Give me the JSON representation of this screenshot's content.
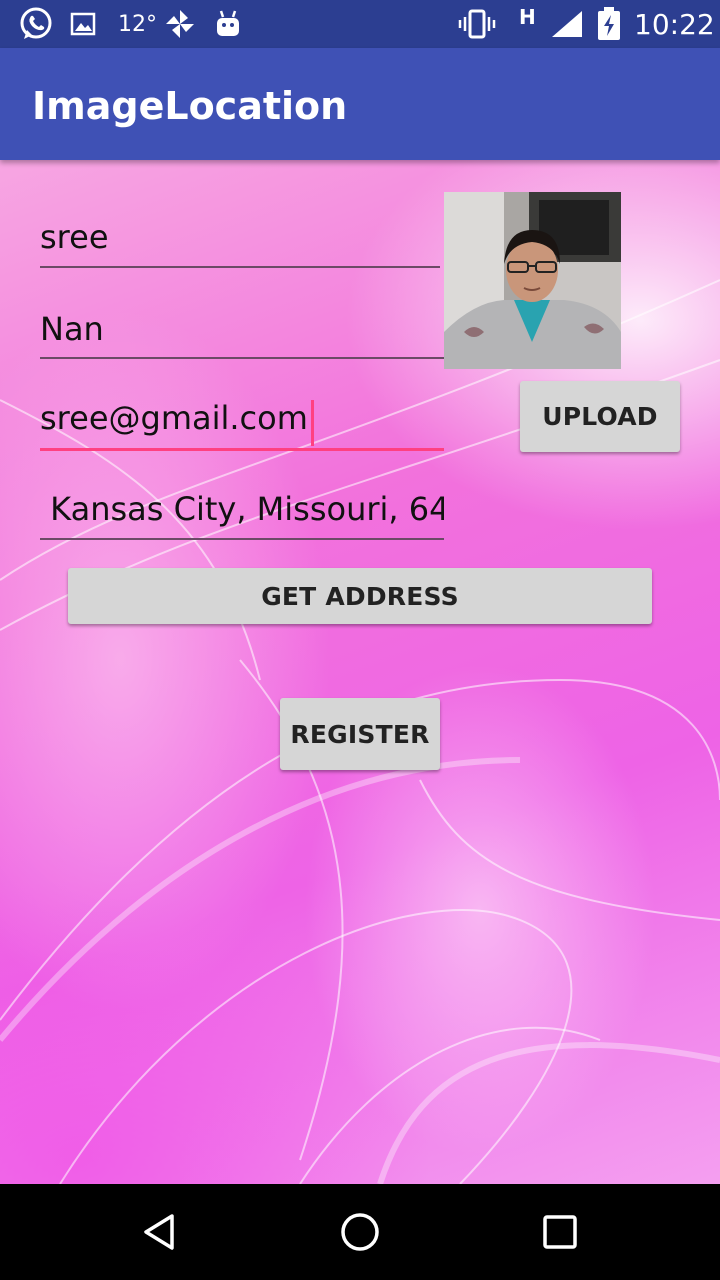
{
  "status_bar": {
    "temperature": "12°",
    "network": "H",
    "time": "10:22",
    "icons": [
      "whatsapp-icon",
      "image-icon",
      "pinwheel-icon",
      "android-icon",
      "vibrate-icon",
      "signal-icon",
      "battery-charging-icon"
    ]
  },
  "app_bar": {
    "title": "ImageLocation"
  },
  "form": {
    "first_name": "sree",
    "last_name": "Nan",
    "email": "sree@gmail.com",
    "address": " Kansas City, Missouri, 64"
  },
  "buttons": {
    "upload": "UPLOAD",
    "get_address": "GET ADDRESS",
    "register": "REGISTER"
  },
  "nav": {
    "icons": [
      "back-icon",
      "home-icon",
      "recents-icon"
    ]
  }
}
